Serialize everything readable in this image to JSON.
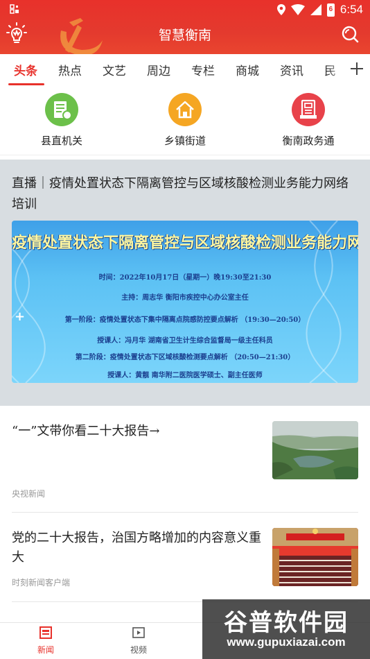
{
  "status_bar": {
    "time": "6:54",
    "battery_level": "6"
  },
  "header": {
    "title": "智慧衡南"
  },
  "tabs": [
    {
      "label": "头条",
      "active": true
    },
    {
      "label": "热点"
    },
    {
      "label": "文艺"
    },
    {
      "label": "周边"
    },
    {
      "label": "专栏"
    },
    {
      "label": "商城"
    },
    {
      "label": "资讯"
    },
    {
      "label": "民"
    }
  ],
  "shortcuts": [
    {
      "label": "县直机关",
      "icon": "building-icon",
      "color": "#6cc04a"
    },
    {
      "label": "乡镇街道",
      "icon": "house-icon",
      "color": "#f5a623"
    },
    {
      "label": "衡南政务通",
      "icon": "document-icon",
      "color": "#e8424a"
    }
  ],
  "featured": {
    "title": "直播｜疫情处置状态下隔离管控与区域核酸检测业务能力网络培训",
    "banner": {
      "headline": "疫情处置状态下隔离管控与区域核酸检测业务能力网络培训",
      "lines": [
        "时间：2022年10月17日（星期一）晚19:30至21:30",
        "主持：周志华  衡阳市疾控中心办公室主任",
        "第一阶段：疫情处置状态下集中隔离点院感防控要点解析  （19:30—20:50）",
        "授课人：冯月华  湖南省卫生计生综合监督局一级主任科员",
        "第二阶段：疫情处置状态下区域核酸检测要点解析  （20:50—21:30）",
        "授课人：黄靓  南华附二医院医学硕士、副主任医师"
      ]
    }
  },
  "news": [
    {
      "title": "“一”文带你看二十大报告→",
      "source": "央视新闻"
    },
    {
      "title": "党的二十大报告，治国方略增加的内容意义重大",
      "source": "时刻新闻客户端"
    }
  ],
  "bottom_nav": [
    {
      "label": "新闻",
      "active": true
    },
    {
      "label": "视频"
    }
  ],
  "watermark": {
    "brand": "谷普软件园",
    "url": "www.gupuxiazai.com"
  },
  "colors": {
    "primary": "#e8312b",
    "featured_bg": "#d8dde1"
  }
}
